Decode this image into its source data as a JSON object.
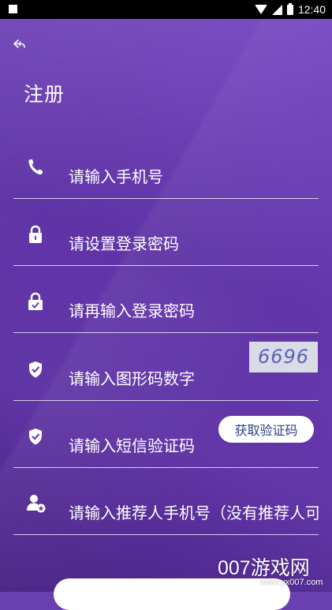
{
  "status_bar": {
    "time": "12:40"
  },
  "header": {
    "title": "注册"
  },
  "form": {
    "phone_placeholder": "请输入手机号",
    "password_placeholder": "请设置登录密码",
    "password_confirm_placeholder": "请再输入登录密码",
    "captcha_placeholder": "请输入图形码数字",
    "captcha_code": "6696",
    "sms_placeholder": "请输入短信验证码",
    "sms_button_label": "获取验证码",
    "referrer_placeholder": "请输入推荐人手机号（没有推荐人可不填）"
  },
  "watermark": {
    "brand": "007游戏网",
    "url": "www.yx007.com"
  },
  "colors": {
    "background": "#6a3fb0",
    "captcha_bg": "#d9dbe6",
    "captcha_text": "#5a63b8",
    "button_text": "#2b3f8a"
  },
  "icons": {
    "back": "back-arrow-icon",
    "phone": "phone-icon",
    "lock": "lock-icon",
    "lock_check": "lock-check-icon",
    "shield": "shield-check-icon",
    "user_star": "user-star-icon"
  }
}
